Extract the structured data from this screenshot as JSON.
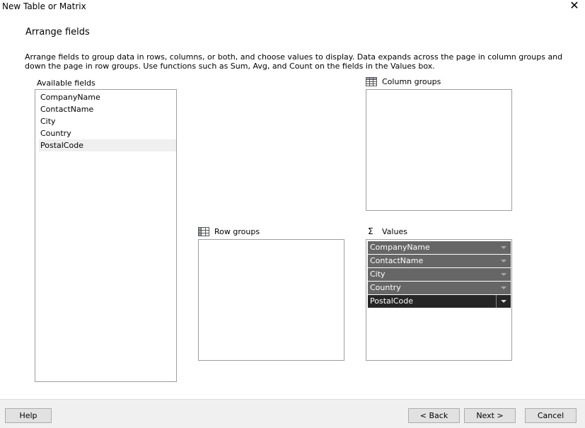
{
  "window": {
    "title": "New Table or Matrix",
    "close_glyph": "✕"
  },
  "page": {
    "heading": "Arrange fields",
    "description": "Arrange fields to group data in rows, columns, or both, and choose values to display. Data expands across the page in column groups and down the page in row groups.  Use functions such as Sum, Avg, and Count on the fields in the Values box."
  },
  "available": {
    "label": "Available fields",
    "items": [
      "CompanyName",
      "ContactName",
      "City",
      "Country",
      "PostalCode"
    ],
    "selected": "PostalCode"
  },
  "column_groups": {
    "label": "Column groups",
    "icon": "table-icon",
    "items": []
  },
  "row_groups": {
    "label": "Row groups",
    "icon": "table-icon",
    "items": []
  },
  "values": {
    "label": "Values",
    "icon": "sigma-icon",
    "icon_glyph": "Σ",
    "items": [
      "CompanyName",
      "ContactName",
      "City",
      "Country",
      "PostalCode"
    ],
    "active": "PostalCode"
  },
  "buttons": {
    "help": "Help",
    "back": "< Back",
    "next": "Next >",
    "cancel": "Cancel"
  }
}
